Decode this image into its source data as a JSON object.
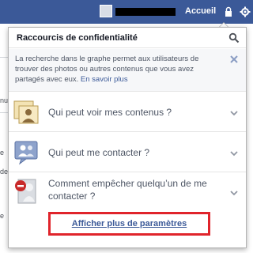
{
  "topbar": {
    "home_label": "Accueil"
  },
  "background": {
    "fragments": [
      "nu",
      "e",
      "de",
      "e"
    ]
  },
  "panel": {
    "title": "Raccourcis de confidentialité",
    "info": {
      "text": "La recherche dans le graphe permet aux utilisateurs de trouver des photos ou autres contenus que vous avez partagés avec eux. ",
      "link": "En savoir plus"
    },
    "options": [
      {
        "label": "Qui peut voir mes contenus ?",
        "icon": "content-visibility-icon"
      },
      {
        "label": "Qui peut me contacter ?",
        "icon": "contact-people-icon"
      },
      {
        "label": "Comment empêcher quelqu’un de me contacter ?",
        "icon": "block-user-icon"
      }
    ],
    "more_settings": "Afficher plus de paramètres"
  },
  "colors": {
    "brand_blue": "#3b5998",
    "highlight_red": "#e0242b"
  }
}
